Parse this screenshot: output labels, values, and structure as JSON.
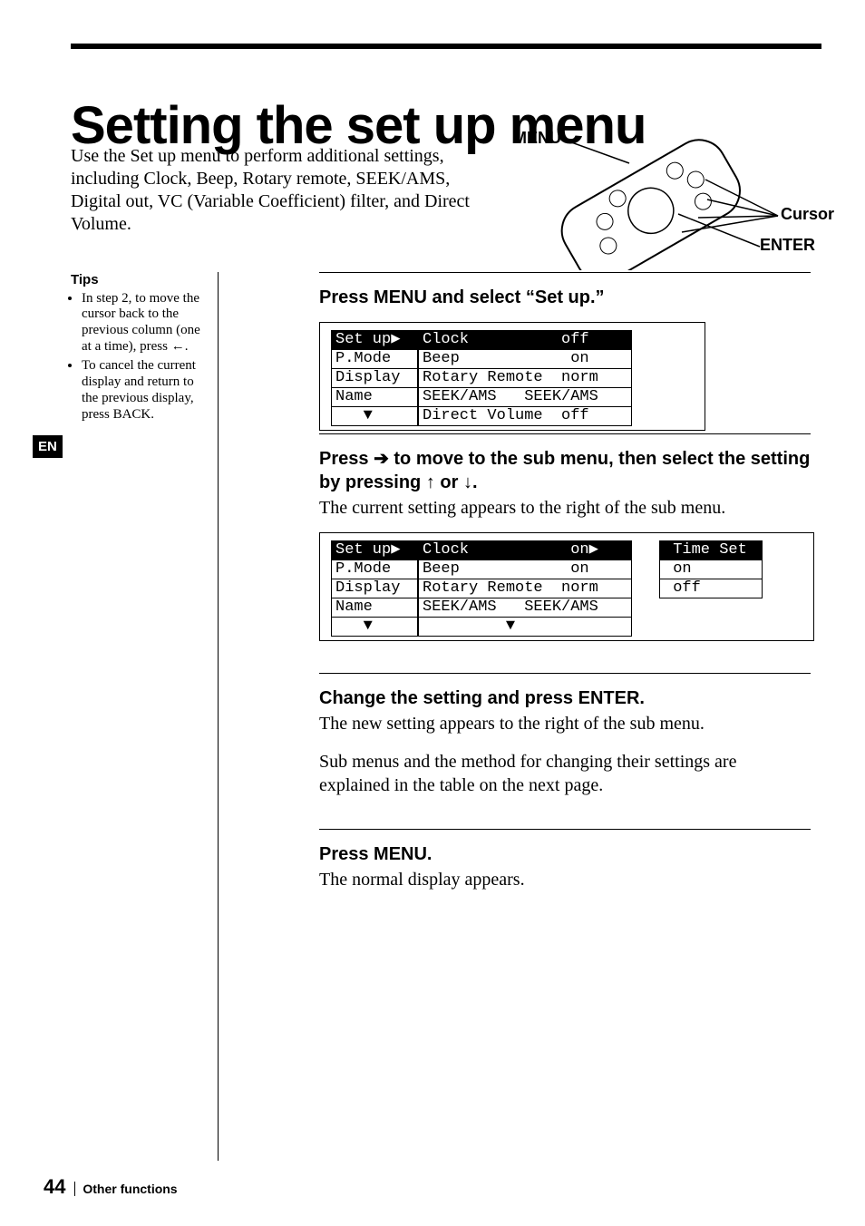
{
  "title": "Setting the set up menu",
  "intro": "Use the Set up menu to perform additional settings, including Clock, Beep, Rotary remote, SEEK/AMS, Digital out, VC (Variable Coefficient) filter, and Direct Volume.",
  "remote": {
    "menu": "MENU",
    "cursor": "Cursor",
    "enter": "ENTER"
  },
  "en": "EN",
  "tips": {
    "heading": "Tips",
    "items": [
      "In step 2, to move the cursor back to the previous column (one at a time), press ←.",
      "To cancel the current display and return to the previous display, press BACK."
    ]
  },
  "step1": {
    "heading": "Press MENU and select “Set up.”",
    "display": {
      "rows": [
        {
          "a": "Set up▶",
          "aInv": true,
          "b": "Clock          off",
          "bInv": true
        },
        {
          "a": "P.Mode",
          "b": "Beep            on"
        },
        {
          "a": "Display",
          "b": "Rotary Remote  norm"
        },
        {
          "a": "Name",
          "b": "SEEK/AMS   SEEK/AMS"
        },
        {
          "a": "   ▼",
          "b": "Direct Volume  off"
        }
      ]
    }
  },
  "step2": {
    "heading_a": "Press ",
    "heading_b": " to move to the sub menu, then select the setting by pressing ",
    "heading_c": " or ",
    "heading_d": ".",
    "arrow_right": "➔",
    "arrow_up": "↑",
    "arrow_down": "↓",
    "para": "The current setting appears to the right of the sub menu.",
    "display": {
      "rows": [
        {
          "a": "Set up▶",
          "aInv": true,
          "b": "Clock           on▶",
          "bInv": true,
          "c": " Time Set",
          "cInv": true
        },
        {
          "a": "P.Mode",
          "b": "Beep            on",
          "c": " on"
        },
        {
          "a": "Display",
          "b": "Rotary Remote  norm",
          "c": " off"
        },
        {
          "a": "Name",
          "b": "SEEK/AMS   SEEK/AMS",
          "c": ""
        },
        {
          "a": "   ▼",
          "b": "         ▼",
          "c": ""
        }
      ]
    }
  },
  "step3": {
    "heading": "Change the setting and press ENTER.",
    "para1": "The new setting appears to the right of the sub menu.",
    "para2": "Sub menus and the method for changing their settings are explained in the table on the next page."
  },
  "step4": {
    "heading": "Press MENU.",
    "para": "The normal display appears."
  },
  "footer": {
    "page": "44",
    "section": "Other functions"
  }
}
